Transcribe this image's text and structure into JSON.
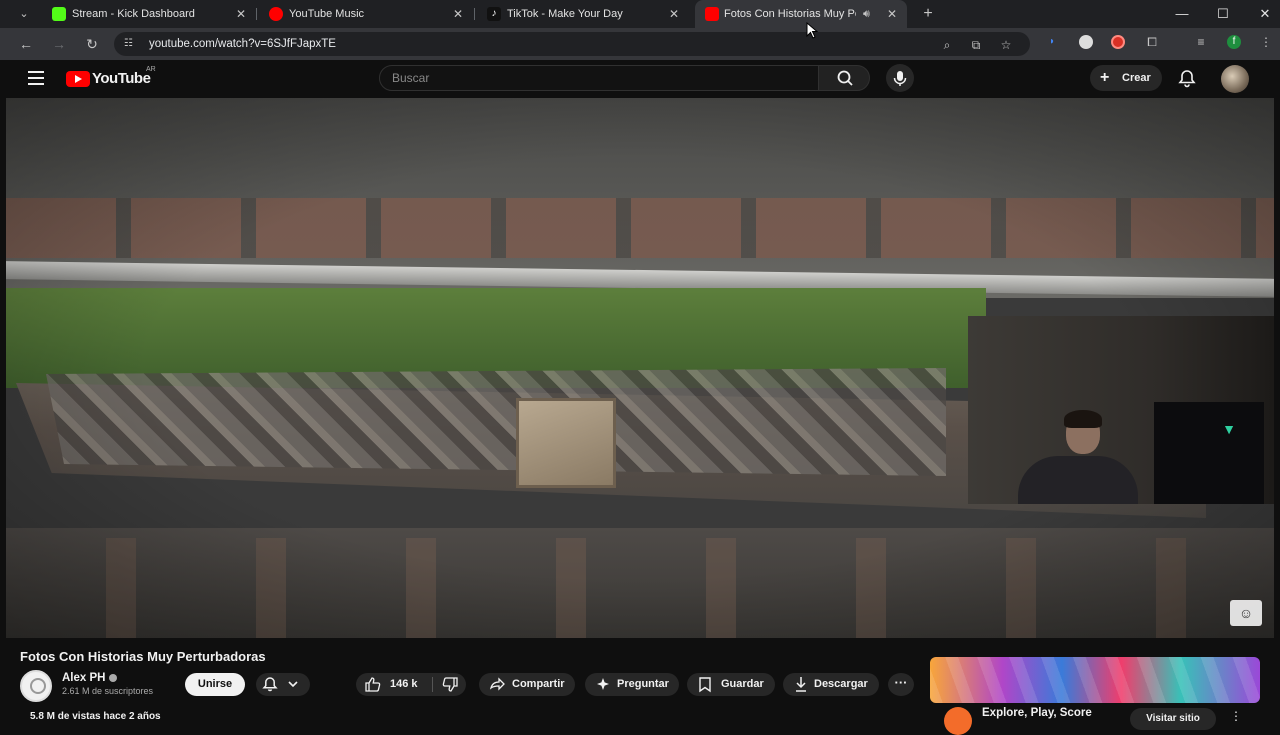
{
  "browser": {
    "tabs": [
      {
        "title": "Stream - Kick Dashboard",
        "favicon": "kick-icon",
        "color": "#53fc18"
      },
      {
        "title": "YouTube Music",
        "favicon": "youtube-music-icon",
        "color": "#ff0000"
      },
      {
        "title": "TikTok - Make Your Day",
        "favicon": "tiktok-icon",
        "color": "#ffffff"
      },
      {
        "title": "Fotos Con Historias Muy Pe",
        "favicon": "youtube-icon",
        "color": "#ff0000",
        "active": true
      }
    ],
    "url": "youtube.com/watch?v=6SJfFJapxTE"
  },
  "youtube": {
    "logo_text": "YouTube",
    "country_code": "AR",
    "search_placeholder": "Buscar",
    "create_label": "Crear"
  },
  "video": {
    "title": "Fotos Con Historias Muy Perturbadoras",
    "channel_name": "Alex PH",
    "subscribers": "2.61 M de suscriptores",
    "join_label": "Unirse",
    "likes": "146 k",
    "share_label": "Compartir",
    "ask_label": "Preguntar",
    "save_label": "Guardar",
    "download_label": "Descargar",
    "views_line": "5.8 M de vistas  hace 2 años"
  },
  "ad": {
    "title": "Explore, Play, Score",
    "visit_label": "Visitar sitio"
  },
  "colors": {
    "youtube_red": "#ff0000",
    "page_bg": "#0f0f0f",
    "button_bg": "#272727"
  }
}
